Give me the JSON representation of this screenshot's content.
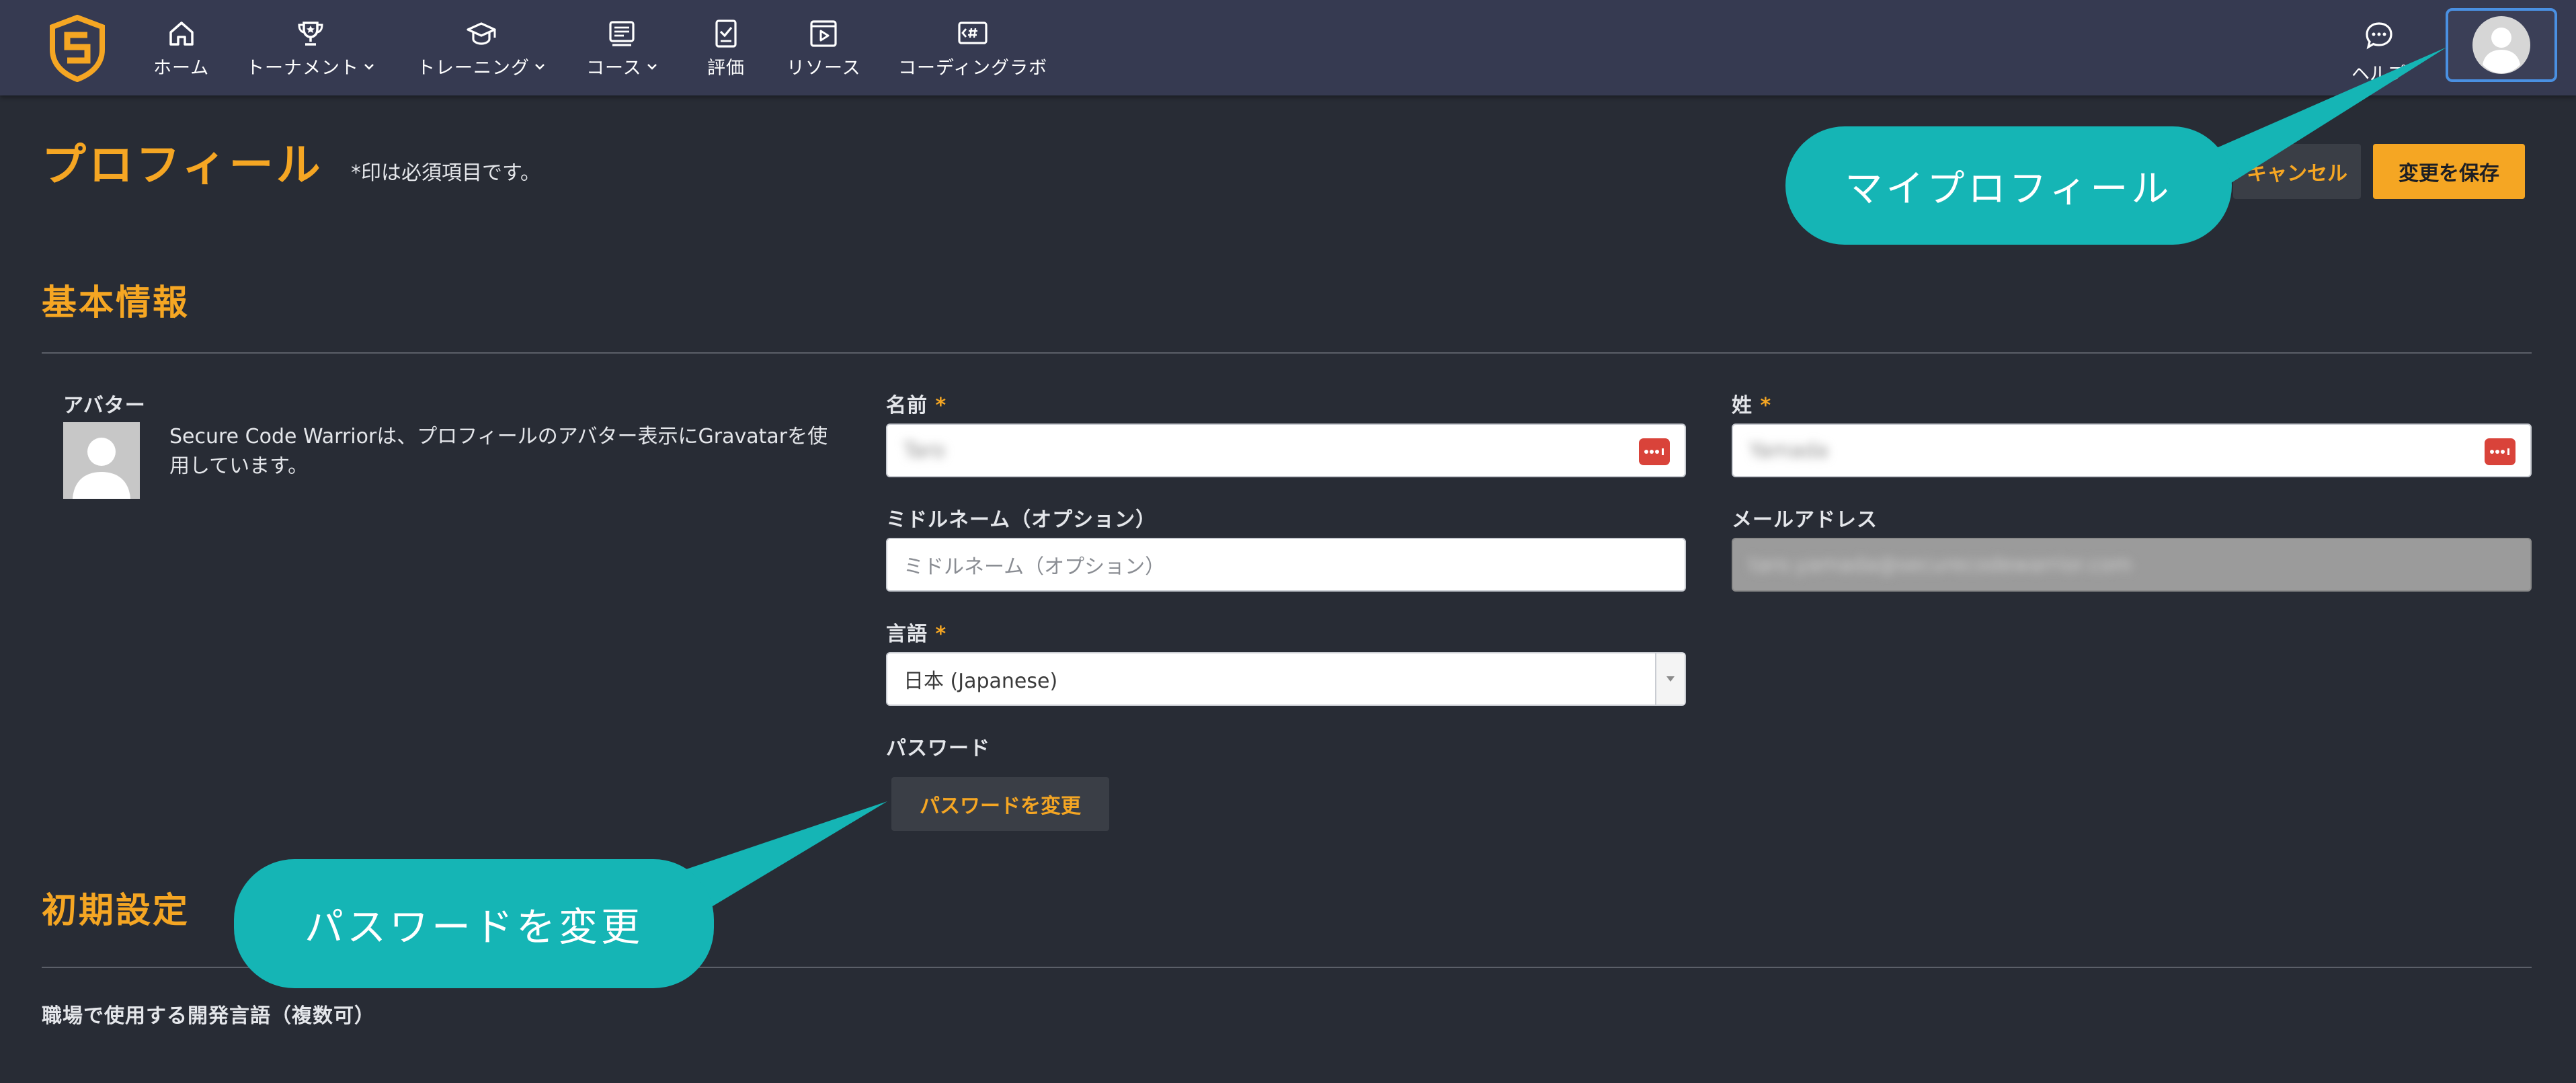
{
  "nav": {
    "items": [
      {
        "label": "ホーム",
        "icon": "home-icon"
      },
      {
        "label": "トーナメント",
        "icon": "trophy-icon",
        "dropdown": true
      },
      {
        "label": "トレーニング",
        "icon": "graduation-cap-icon",
        "dropdown": true
      },
      {
        "label": "コース",
        "icon": "course-icon",
        "dropdown": true
      },
      {
        "label": "評価",
        "icon": "assessment-icon"
      },
      {
        "label": "リソース",
        "icon": "resource-icon"
      },
      {
        "label": "コーディングラボ",
        "icon": "coding-lab-icon"
      }
    ],
    "help_label": "ヘルプ"
  },
  "header": {
    "title": "プロフィール",
    "required_note": "*印は必須項目です。",
    "cancel_label": "キャンセル",
    "save_label": "変更を保存"
  },
  "basic": {
    "title": "基本情報",
    "avatar_label": "アバター",
    "avatar_desc": "Secure Code Warriorは、プロフィールのアバター表示にGravatarを使用しています。",
    "first_name_label": "名前",
    "first_name_value": "Taro",
    "last_name_label": "姓",
    "last_name_value": "Yamada",
    "middle_name_label": "ミドルネーム（オプション）",
    "middle_name_placeholder": "ミドルネーム（オプション）",
    "email_label": "メールアドレス",
    "email_value": "taro.yamada@securecodewarrior.com",
    "language_label": "言語",
    "language_value": "日本 (Japanese)",
    "password_label": "パスワード",
    "password_button": "パスワードを変更",
    "required_mark": "*"
  },
  "prefs": {
    "title": "初期設定",
    "dev_lang_label": "職場で使用する開発言語（複数可）"
  },
  "callouts": {
    "profile": "マイプロフィール",
    "password": "パスワードを変更"
  },
  "colors": {
    "accent": "#f5a623",
    "callout": "#15b5b5",
    "nav_bg": "#363a51",
    "page_bg": "#282c35"
  }
}
